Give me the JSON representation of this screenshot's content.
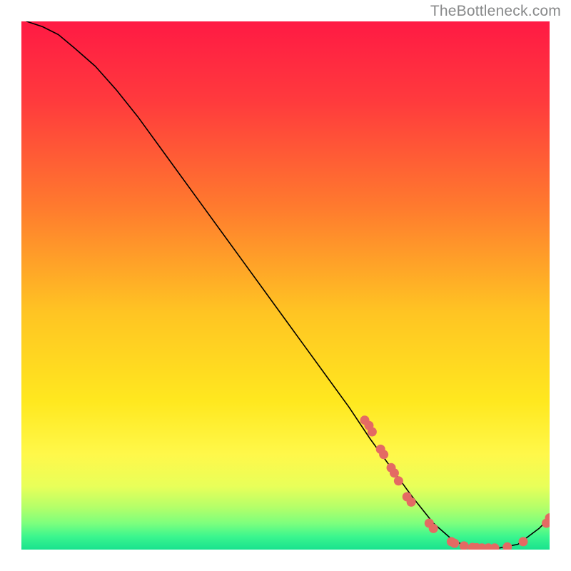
{
  "watermark": "TheBottleneck.com",
  "chart_data": {
    "type": "line",
    "title": "",
    "xlabel": "",
    "ylabel": "",
    "xlim": [
      0,
      100
    ],
    "ylim": [
      0,
      100
    ],
    "grid": false,
    "legend": false,
    "gradient_stops": [
      {
        "offset": 0.0,
        "color": "#ff1a44"
      },
      {
        "offset": 0.15,
        "color": "#ff3a3d"
      },
      {
        "offset": 0.35,
        "color": "#ff7a2e"
      },
      {
        "offset": 0.55,
        "color": "#ffc423"
      },
      {
        "offset": 0.72,
        "color": "#ffe81f"
      },
      {
        "offset": 0.82,
        "color": "#fff84a"
      },
      {
        "offset": 0.88,
        "color": "#e9ff59"
      },
      {
        "offset": 0.92,
        "color": "#b4ff69"
      },
      {
        "offset": 0.95,
        "color": "#7dff7d"
      },
      {
        "offset": 0.975,
        "color": "#3cf68e"
      },
      {
        "offset": 1.0,
        "color": "#18e28e"
      }
    ],
    "series": [
      {
        "name": "bottleneck-curve",
        "x": [
          1,
          4,
          7,
          10,
          14,
          18,
          22,
          26,
          30,
          34,
          38,
          42,
          46,
          50,
          54,
          58,
          62,
          66,
          70,
          74,
          78,
          82,
          86,
          90,
          94,
          98,
          100
        ],
        "y": [
          100,
          99,
          97.5,
          95,
          91.5,
          87,
          82,
          76.5,
          71,
          65.5,
          60,
          54.5,
          49,
          43.5,
          38,
          32.5,
          27,
          21,
          15.5,
          10,
          5,
          1.5,
          0.3,
          0.2,
          1,
          4,
          6
        ],
        "color": "#000000",
        "lw": 1.6
      }
    ],
    "scatter": {
      "name": "scatter-points",
      "color": "#e46a63",
      "radius": 6.5,
      "points": [
        {
          "x": 65,
          "y": 24.5
        },
        {
          "x": 65.8,
          "y": 23.5
        },
        {
          "x": 66.4,
          "y": 22.3
        },
        {
          "x": 68.0,
          "y": 19.0
        },
        {
          "x": 68.6,
          "y": 18.0
        },
        {
          "x": 70.0,
          "y": 15.5
        },
        {
          "x": 70.6,
          "y": 14.5
        },
        {
          "x": 71.4,
          "y": 13.0
        },
        {
          "x": 73.0,
          "y": 10.0
        },
        {
          "x": 73.8,
          "y": 9.0
        },
        {
          "x": 77.2,
          "y": 5.0
        },
        {
          "x": 78.0,
          "y": 4.0
        },
        {
          "x": 81.4,
          "y": 1.5
        },
        {
          "x": 82.0,
          "y": 1.2
        },
        {
          "x": 83.8,
          "y": 0.7
        },
        {
          "x": 85.4,
          "y": 0.4
        },
        {
          "x": 86.2,
          "y": 0.35
        },
        {
          "x": 87.2,
          "y": 0.3
        },
        {
          "x": 88.4,
          "y": 0.3
        },
        {
          "x": 89.6,
          "y": 0.3
        },
        {
          "x": 92.0,
          "y": 0.5
        },
        {
          "x": 95.0,
          "y": 1.5
        },
        {
          "x": 99.4,
          "y": 5.0
        },
        {
          "x": 100.0,
          "y": 6.0
        }
      ]
    }
  }
}
